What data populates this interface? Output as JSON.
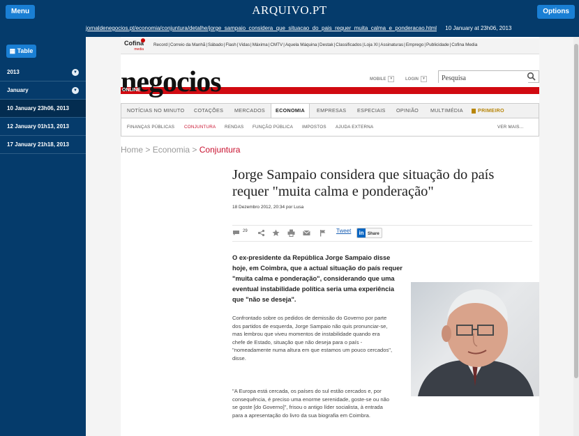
{
  "topbar": {
    "menu_label": "Menu",
    "brand": "ARQUIVO.PT",
    "options_label": "Options",
    "url": "jornaldenegocios.pt/economia/conjuntura/detalhe/jorge_sampaio_considera_que_situacao_do_pais_requer_muita_calma_e_ponderacao.html",
    "capture_date": "10 January at 23h06, 2013"
  },
  "sidebar": {
    "table_label": "Table",
    "year": "2013",
    "month": "January",
    "captures": [
      {
        "label": "10 January 23h06, 2013",
        "active": true
      },
      {
        "label": "12 January 01h13, 2013",
        "active": false
      },
      {
        "label": "17 January 21h18, 2013",
        "active": false
      }
    ]
  },
  "cofina": {
    "logo": "Cofina",
    "logo_sub": "media",
    "links": [
      "Record",
      "Correio da Manhã",
      "Sábado",
      "Flash",
      "Vidas",
      "Máxima",
      "CMTV",
      "Aquela Máquina",
      "Destak",
      "Classificados",
      "Loja XI",
      "Assinaturas",
      "Emprego",
      "Publicidade",
      "Cofina Media"
    ]
  },
  "header": {
    "logo": "negocios",
    "logo_sub": "ONLINE",
    "mobile": "MOBILE",
    "login": "LOGIN",
    "search_placeholder": "Pesquisa",
    "accent_color": "#d10a11"
  },
  "nav": {
    "items": [
      "NOTÍCIAS NO MINUTO",
      "COTAÇÕES",
      "MERCADOS",
      "ECONOMIA",
      "EMPRESAS",
      "ESPECIAIS",
      "OPINIÃO",
      "MULTIMÉDIA",
      "PRIMEIRO"
    ],
    "active": "ECONOMIA",
    "sub_items": [
      "FINANÇAS PÚBLICAS",
      "CONJUNTURA",
      "RENDAS",
      "FUNÇÃO PÚBLICA",
      "IMPOSTOS",
      "AJUDA EXTERNA"
    ],
    "sub_active": "CONJUNTURA",
    "more": "VER MAIS..."
  },
  "breadcrumb": {
    "home": "Home",
    "section": "Economia",
    "current": "Conjuntura"
  },
  "article": {
    "title": "Jorge Sampaio considera que situação do país requer \"muita calma e ponderação\"",
    "meta": "18 Dezembro 2012, 20:34 por Lusa",
    "comment_count": "29",
    "tweet": "Tweet",
    "share": "Share",
    "lead": "O ex-presidente da República Jorge Sampaio disse hoje, em Coimbra, que a actual situação do país requer \"muita calma e ponderação\", considerando que uma eventual instabilidade política seria uma experiência que \"não se deseja\".",
    "paragraphs": [
      "Confrontado sobre os pedidos de demissão do Governo por parte dos partidos de esquerda, Jorge Sampaio não quis pronunciar-se, mas lembrou que viveu momentos de instabilidade quando era chefe de Estado, situação que não deseja para o país - \"nomeadamente numa altura em que estamos um pouco cercados\", disse.",
      "\"A Europa está cercada, os países do sul estão cercados e, por consequência, é preciso uma enorme serenidade, goste-se ou não se goste [do Governo]\", frisou o antigo líder socialista, à entrada para a apresentação do livro da sua biografia em Coimbra."
    ]
  }
}
